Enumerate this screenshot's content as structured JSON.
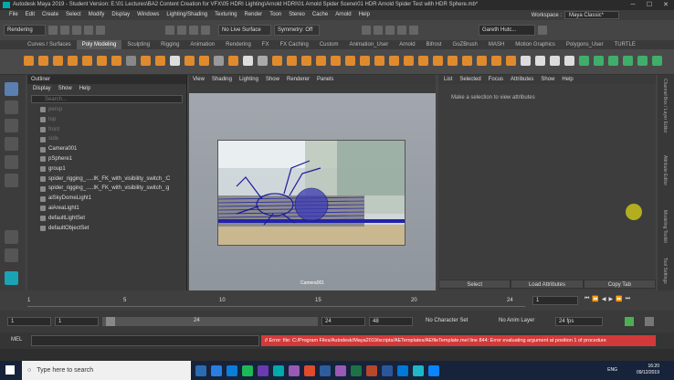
{
  "title_bar": {
    "text": "Autodesk Maya 2019 - Student Version: E:\\01 Lectures\\BA2 Content Creation for VFX\\05 HDRI Lighting\\Arnold HDRI\\01 Arnold Spider Scene\\01 HDR Arnold Spider Test with HDR Sphere.mb*"
  },
  "menus": [
    "File",
    "Edit",
    "Create",
    "Select",
    "Modify",
    "Display",
    "Windows",
    "Lighting/Shading",
    "Texturing",
    "Render",
    "Toon",
    "Stereo",
    "Cache",
    "Arnold",
    "Help"
  ],
  "workspace": {
    "label": "Workspace :",
    "value": "Maya Classic*"
  },
  "status_line": {
    "mode": "Rendering",
    "live_surface": "No Live Surface",
    "symmetry": "Symmetry: Off",
    "user": "Gareth Hutc..."
  },
  "shelf_tabs": [
    "Curves / Surfaces",
    "Poly Modeling",
    "Sculpting",
    "Rigging",
    "Animation",
    "Rendering",
    "FX",
    "FX Caching",
    "Custom",
    "Animation_User",
    "Arnold",
    "Bifrost",
    "GoZBrush",
    "MASH",
    "Motion Graphics",
    "Polygons_User",
    "TURTLE"
  ],
  "shelf_selected": "Poly Modeling",
  "outliner": {
    "title": "Outliner",
    "menu": [
      "Display",
      "Show",
      "Help"
    ],
    "search_placeholder": "Search...",
    "items": [
      {
        "label": "persp",
        "dim": true
      },
      {
        "label": "top",
        "dim": true
      },
      {
        "label": "front",
        "dim": true
      },
      {
        "label": "side",
        "dim": true
      },
      {
        "label": "Camera001",
        "dim": false
      },
      {
        "label": "pSphere1",
        "dim": false
      },
      {
        "label": "group1",
        "dim": false
      },
      {
        "label": "spider_rigging_.....IK_FK_with_visibility_switch_:C",
        "dim": false
      },
      {
        "label": "spider_rigging_.....IK_FK_with_visibility_switch_:g",
        "dim": false
      },
      {
        "label": "aiSkyDomeLight1",
        "dim": false
      },
      {
        "label": "aiAreaLight1",
        "dim": false
      },
      {
        "label": "defaultLightSet",
        "dim": false
      },
      {
        "label": "defaultObjectSet",
        "dim": false
      }
    ]
  },
  "viewport": {
    "menu": [
      "View",
      "Shading",
      "Lighting",
      "Show",
      "Renderer",
      "Panels"
    ],
    "camera_label": "Camera001"
  },
  "attribute_editor": {
    "menu": [
      "List",
      "Selected",
      "Focus",
      "Attributes",
      "Show",
      "Help"
    ],
    "message": "Make a selection to view attributes",
    "buttons": [
      "Select",
      "Load Attributes",
      "Copy Tab"
    ]
  },
  "side_tabs": [
    "Channel Box / Layer Editor",
    "Attribute Editor",
    "Modeling Toolkit",
    "Tool Settings"
  ],
  "time_slider": {
    "ticks": [
      "1",
      "5",
      "10",
      "15",
      "20",
      "24"
    ],
    "current_frame": "1"
  },
  "range_slider": {
    "start": "1",
    "range_start": "1",
    "range_end": "24",
    "end": "24",
    "anim_end": "48",
    "character_set": "No Character Set",
    "anim_layer": "No Anim Layer",
    "fps": "24 fps"
  },
  "command_line": {
    "label": "MEL",
    "error": "// Error: file: C:/Program Files/Autodesk/Maya2019/scripts/AETemplates/AEfileTemplate.mel line 844: Error evaluating argument at position 1 of procedure"
  },
  "taskbar": {
    "search": "Type here to search",
    "lang": "ENG",
    "time": "16:20",
    "date": "09/12/2019"
  }
}
